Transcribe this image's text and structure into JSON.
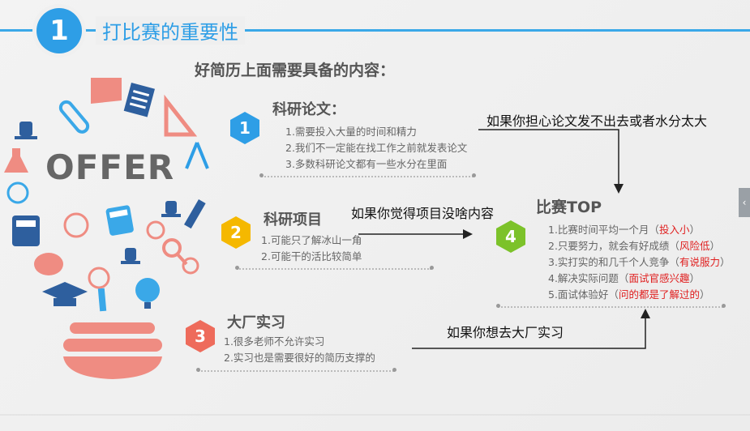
{
  "header": {
    "number": "1",
    "title": "打比赛的重要性"
  },
  "subhead": "好简历上面需要具备的内容：",
  "illustration": {
    "label": "OFFER"
  },
  "sections": {
    "research_paper": {
      "number": "1",
      "title": "科研论文：",
      "items": [
        "1.需要投入大量的时间和精力",
        "2.我们不一定能在找工作之前就发表论文",
        "3.多数科研论文都有一些水分在里面"
      ]
    },
    "research_project": {
      "number": "2",
      "title": "科研项目",
      "items": [
        "1.可能只了解冰山一角",
        "2.可能干的活比较简单"
      ]
    },
    "internship": {
      "number": "3",
      "title": "大厂实习",
      "items": [
        "1.很多老师不允许实习",
        "2.实习也是需要很好的简历支撑的"
      ]
    },
    "competition": {
      "number": "4",
      "title": "比赛TOP",
      "items": [
        {
          "text": "1.比赛时间平均一个月（",
          "hl": "投入小",
          "end": "）"
        },
        {
          "text": "2.只要努力，就会有好成绩（",
          "hl": "风险低",
          "end": "）"
        },
        {
          "text": "3.实打实的和几千个人竞争（",
          "hl": "有说服力",
          "end": "）"
        },
        {
          "text": "4.解决实际问题（",
          "hl": "面试官感兴趣",
          "end": "）"
        },
        {
          "text": "5.面试体验好（",
          "hl": "问的都是了解过的",
          "end": "）"
        }
      ]
    }
  },
  "notes": {
    "paper_worry": "如果你担心论文发不出去或者水分太大",
    "project_worry": "如果你觉得项目没啥内容",
    "internship_want": "如果你想去大厂实习"
  },
  "colors": {
    "blue": "#2e9ee6",
    "yellow": "#f5b800",
    "red_orange": "#ee6b5b",
    "green": "#7cc22a",
    "highlight": "#e02020"
  },
  "side_tab": {
    "glyph": "‹"
  }
}
